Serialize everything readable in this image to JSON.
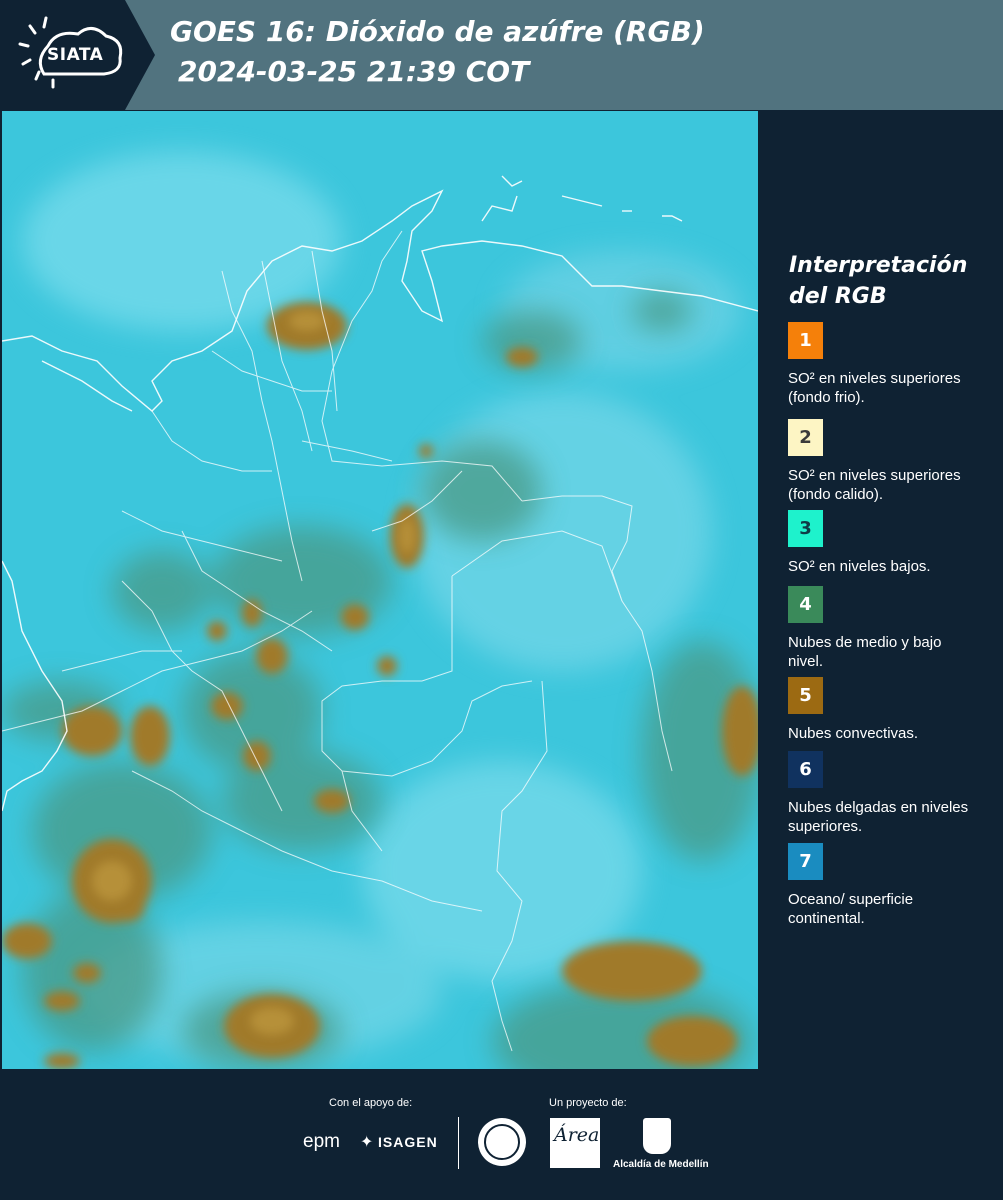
{
  "header": {
    "logo_text": "SIATA",
    "title_line1": "GOES 16: Dióxido de azúfre (RGB)",
    "title_line2": "2024-03-25 21:39 COT"
  },
  "legend": {
    "title_line1": "Interpretación",
    "title_line2": "del RGB",
    "items": [
      {
        "number": "1",
        "color": "#f5800a",
        "text_color": "#ffffff",
        "text": "SO² en niveles superiores (fondo frio)."
      },
      {
        "number": "2",
        "color": "#fdf5c4",
        "text_color": "#3b3b3b",
        "text": "SO² en niveles superiores (fondo calido)."
      },
      {
        "number": "3",
        "color": "#1ef2cc",
        "text_color": "#0f3b47",
        "text": "SO² en niveles bajos."
      },
      {
        "number": "4",
        "color": "#3a8a5a",
        "text_color": "#ffffff",
        "text": "Nubes de medio y bajo nivel."
      },
      {
        "number": "5",
        "color": "#9c6a12",
        "text_color": "#ffffff",
        "text": "Nubes convectivas."
      },
      {
        "number": "6",
        "color": "#10325f",
        "text_color": "#ffffff",
        "text": "Nubes delgadas en niveles superiores."
      },
      {
        "number": "7",
        "color": "#1a8cc0",
        "text_color": "#ffffff",
        "text": "Oceano/ superficie continental."
      }
    ]
  },
  "footer": {
    "support_label": "Con el apoyo de:",
    "project_label": "Un proyecto de:",
    "sponsor_epm": "epm",
    "sponsor_isagen": "ISAGEN",
    "alcaldia": "Alcaldía de Medellín",
    "area_text": "Área"
  },
  "colors": {
    "header_bg": "#51737f",
    "panel_bg": "#0f2233",
    "map_base": "#3cc6dc"
  }
}
